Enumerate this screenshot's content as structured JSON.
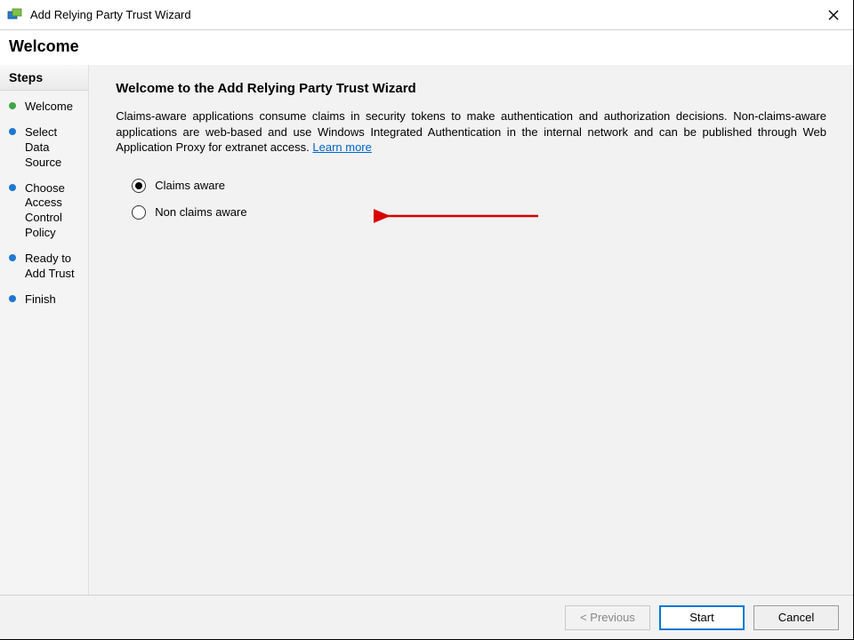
{
  "titlebar": {
    "title": "Add Relying Party Trust Wizard"
  },
  "page": {
    "heading": "Welcome"
  },
  "sidebar": {
    "header": "Steps",
    "items": [
      {
        "label": "Welcome",
        "active": true
      },
      {
        "label": "Select Data Source",
        "active": false
      },
      {
        "label": "Choose Access Control Policy",
        "active": false
      },
      {
        "label": "Ready to Add Trust",
        "active": false
      },
      {
        "label": "Finish",
        "active": false
      }
    ]
  },
  "main": {
    "title": "Welcome to the Add Relying Party Trust Wizard",
    "description": "Claims-aware applications consume claims in security tokens to make authentication and authorization decisions. Non-claims-aware applications are web-based and use Windows Integrated Authentication in the internal network and can be published through Web Application Proxy for extranet access. ",
    "learn_more": "Learn more",
    "options": {
      "claims_aware": "Claims aware",
      "non_claims_aware": "Non claims aware",
      "selected": "claims_aware"
    }
  },
  "footer": {
    "previous": "< Previous",
    "start": "Start",
    "cancel": "Cancel"
  },
  "annotation": {
    "arrow_color": "#d80000"
  }
}
